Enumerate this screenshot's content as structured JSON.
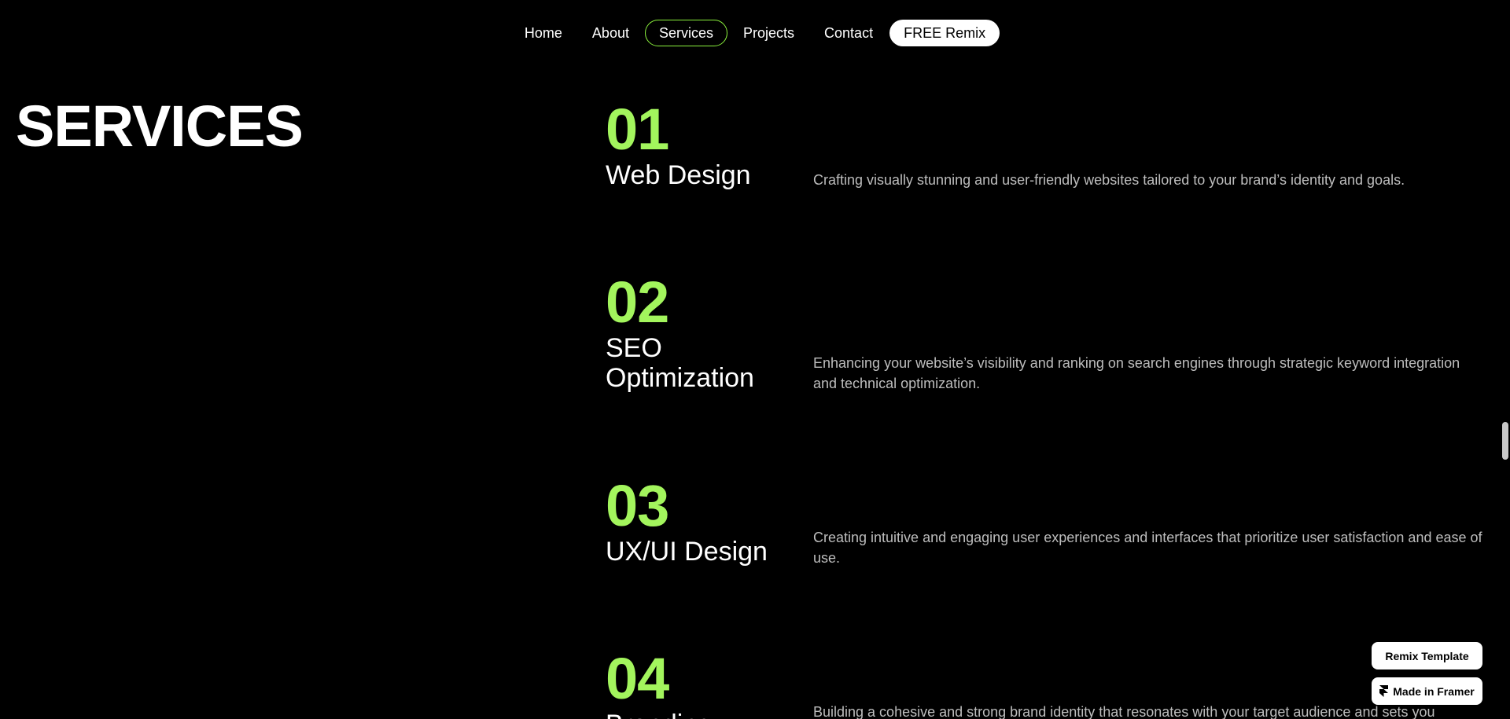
{
  "nav": {
    "items": [
      {
        "label": "Home"
      },
      {
        "label": "About"
      },
      {
        "label": "Services"
      },
      {
        "label": "Projects"
      },
      {
        "label": "Contact"
      }
    ],
    "cta_label": "FREE Remix",
    "active_item": "Services",
    "accent_color": "#8bf23d"
  },
  "page_title": "SERVICES",
  "services": [
    {
      "number": "01",
      "name": "Web Design",
      "description": "Crafting visually stunning and user-friendly websites tailored to your brand’s identity and goals."
    },
    {
      "number": "02",
      "name": "SEO Optimization",
      "description": "Enhancing your website’s visibility and ranking on search engines through strategic keyword integration and technical optimization."
    },
    {
      "number": "03",
      "name": "UX/UI Design",
      "description": "Creating intuitive and engaging user experiences and interfaces that prioritize user satisfaction and ease of use."
    },
    {
      "number": "04",
      "name": "Branding",
      "description": "Building a cohesive and strong brand identity that resonates with your target audience and sets you"
    }
  ],
  "badges": {
    "remix_template": "Remix Template",
    "made_in_framer": "Made in Framer",
    "framer_icon": "framer-logo-icon"
  },
  "colors": {
    "number_green": "#a3f55d",
    "background": "#000000",
    "description_gray": "#bdbdbd"
  }
}
